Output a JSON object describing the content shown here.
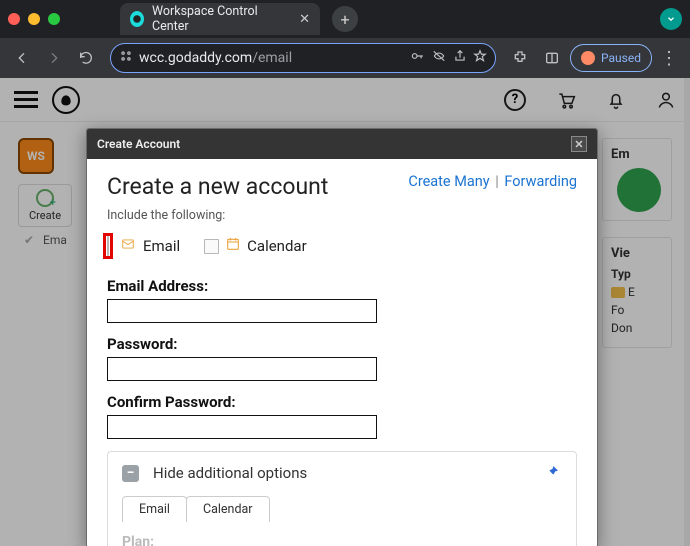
{
  "browser": {
    "tab_title": "Workspace Control Center",
    "url_display_host": "wcc.godaddy.com",
    "url_display_path": "/email",
    "paused_label": "Paused"
  },
  "app": {
    "avatar_label": "WS",
    "create_label": "Create",
    "list_item0": "Ema"
  },
  "sidepanels": {
    "panel1_title": "Em",
    "panel2_title": "Vie",
    "panel2_type_label": "Typ",
    "panel2_row1": "E",
    "panel2_row2": "Fo",
    "panel2_row3": "Don"
  },
  "modal": {
    "header": "Create Account",
    "title": "Create a new account",
    "link_create_many": "Create Many",
    "link_forwarding": "Forwarding",
    "separator": "|",
    "include_label": "Include the following:",
    "include_email": "Email",
    "include_calendar": "Calendar",
    "field_email_label": "Email Address:",
    "field_password_label": "Password:",
    "field_confirm_label": "Confirm Password:",
    "email_value": "",
    "password_value": "",
    "confirm_value": "",
    "hide_options": "Hide additional options",
    "tab_email": "Email",
    "tab_calendar": "Calendar",
    "plan_label": "Plan:"
  }
}
